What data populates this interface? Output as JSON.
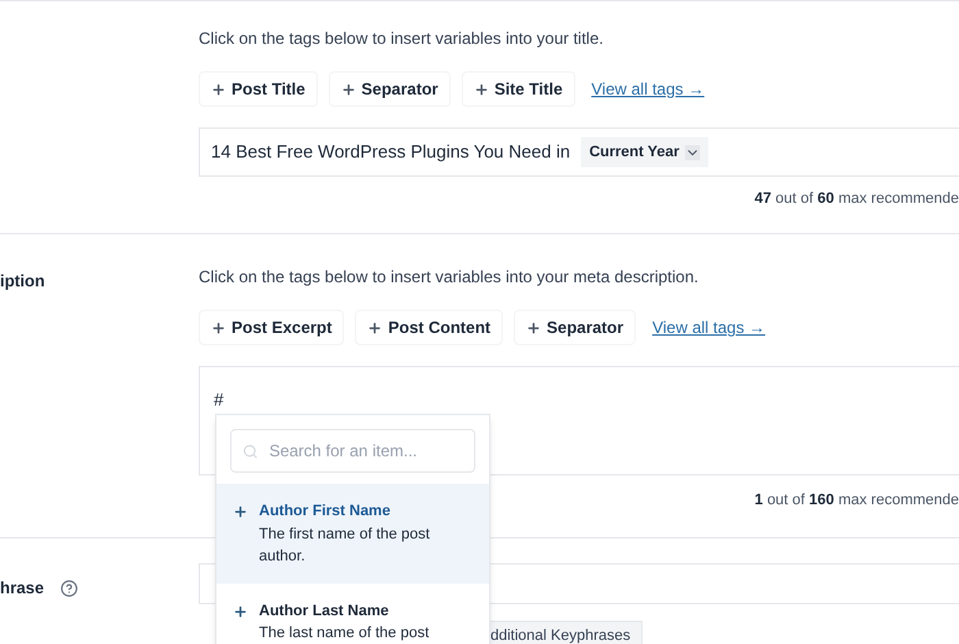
{
  "title_section": {
    "hint": "Click on the tags below to insert variables into your title.",
    "tags": [
      "Post Title",
      "Separator",
      "Site Title"
    ],
    "view_all": "View all tags →",
    "field": {
      "text": "14 Best Free WordPress Plugins You Need in",
      "tag": "Current Year"
    },
    "counter": {
      "count": "47",
      "middle": "out of",
      "max": "60",
      "suffix": "max recommende"
    }
  },
  "description_section": {
    "label": "iption",
    "hint": "Click on the tags below to insert variables into your meta description.",
    "tags": [
      "Post Excerpt",
      "Post Content",
      "Separator"
    ],
    "view_all": "View all tags →",
    "field": {
      "value": "#"
    },
    "counter": {
      "count": "1",
      "middle": "out of",
      "max": "160",
      "suffix": "max recommende"
    }
  },
  "keyphrase_section": {
    "label": "hrase",
    "button": "dditional Keyphrases"
  },
  "dropdown": {
    "search": {
      "placeholder": "Search for an item..."
    },
    "items": [
      {
        "name": "Author First Name",
        "description": "The first name of the post author.",
        "selected": true
      },
      {
        "name": "Author Last Name",
        "description": "The last name of the post",
        "selected": false
      }
    ]
  }
}
